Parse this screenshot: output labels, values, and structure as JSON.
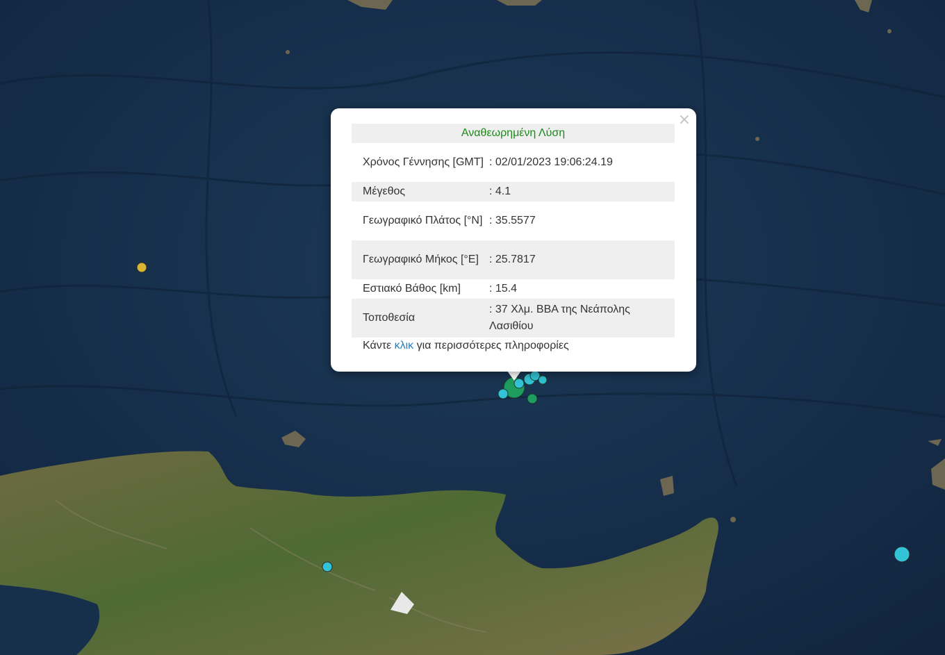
{
  "popup": {
    "close_symbol": "×",
    "title": "Αναθεωρημένη Λύση",
    "rows": [
      {
        "label": "Χρόνος Γέννησης [GMT]",
        "value": ": 02/01/2023 19:06:24.19"
      },
      {
        "label": "Μέγεθος",
        "value": ": 4.1"
      },
      {
        "label": "Γεωγραφικό Πλάτος [°N]",
        "value": ": 35.5577"
      },
      {
        "label": "Γεωγραφικό Μήκος [°E]",
        "value": ": 25.7817"
      },
      {
        "label": "Εστιακό Βάθος [km]",
        "value": ": 15.4"
      },
      {
        "label": "Τοποθεσία",
        "value": ": 37 Χλμ. ΒΒΑ της Νεάπολης Λασιθίου"
      }
    ],
    "footer_before": "Κάντε ",
    "footer_link": "κλικ",
    "footer_after": " για περισσότερες πληροφορίες"
  },
  "map": {
    "sea_color": "#16304b",
    "land_color": "#5c6e3c",
    "marker_colors": {
      "recent": "#33c3d6",
      "older": "#1f9c5f",
      "oldest": "#d9b536"
    }
  }
}
